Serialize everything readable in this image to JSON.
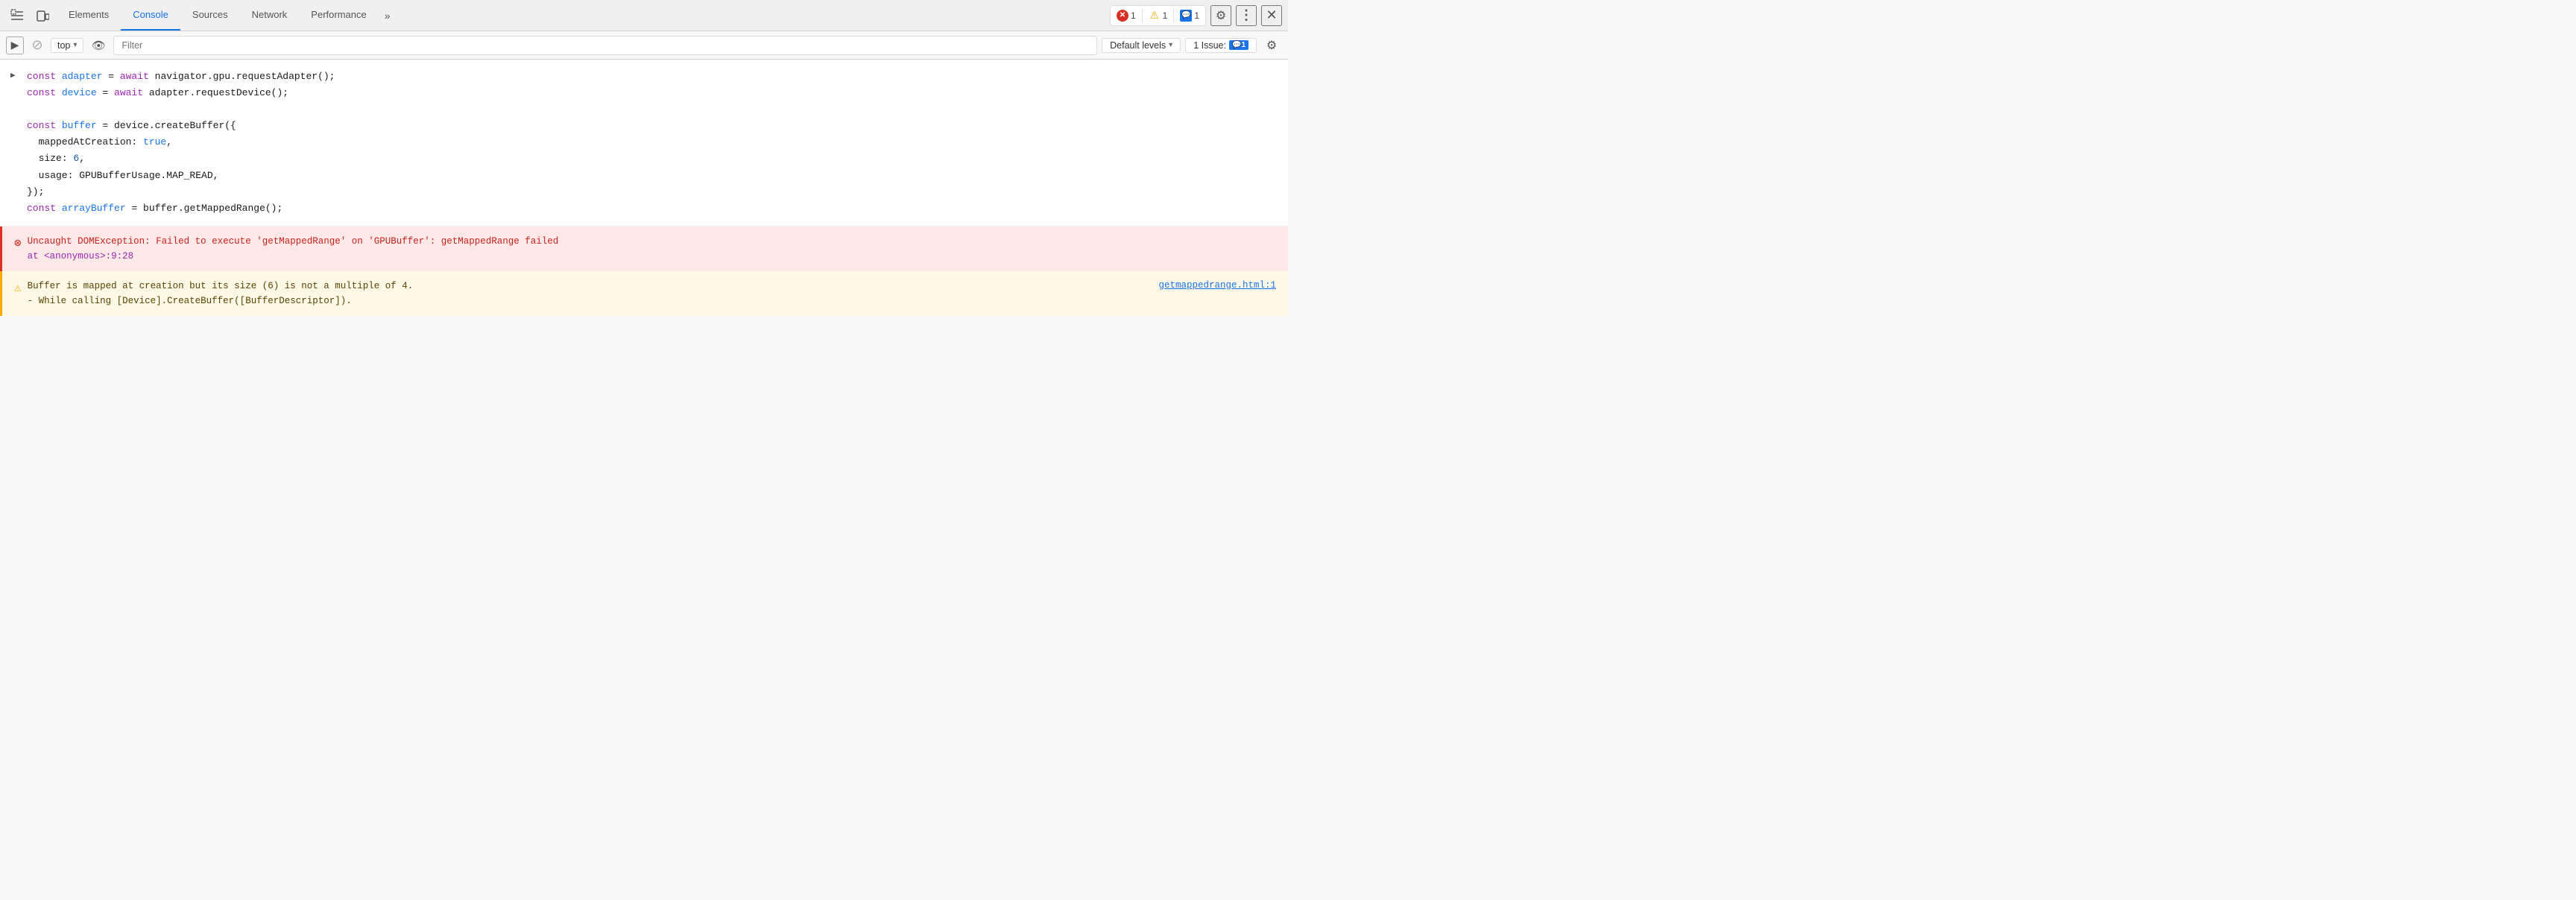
{
  "toolbar": {
    "inspect_icon": "⊹",
    "device_icon": "⬜",
    "tabs": [
      {
        "label": "Elements",
        "active": false
      },
      {
        "label": "Console",
        "active": true
      },
      {
        "label": "Sources",
        "active": false
      },
      {
        "label": "Network",
        "active": false
      },
      {
        "label": "Performance",
        "active": false
      }
    ],
    "more_label": "»",
    "error_count": "1",
    "warning_count": "1",
    "issue_count": "1",
    "gear_icon": "⚙",
    "dots_icon": "⋮",
    "close_icon": "✕"
  },
  "secondbar": {
    "sidebar_icon": "▶",
    "clear_icon": "⊘",
    "context_label": "top",
    "eye_icon": "👁",
    "filter_placeholder": "Filter",
    "level_label": "Default levels",
    "issues_label": "1 Issue:",
    "issues_count": "1",
    "gear_icon": "⚙"
  },
  "console": {
    "code_lines": [
      {
        "type": "code",
        "has_arrow": true,
        "parts": [
          {
            "text": "const ",
            "class": "c-purple"
          },
          {
            "text": "adapter",
            "class": "c-blue"
          },
          {
            "text": " = ",
            "class": "c-black"
          },
          {
            "text": "await ",
            "class": "c-purple"
          },
          {
            "text": "navigator.gpu.requestAdapter();",
            "class": "c-black"
          }
        ]
      },
      {
        "type": "code",
        "has_arrow": false,
        "parts": [
          {
            "text": "const ",
            "class": "c-purple"
          },
          {
            "text": "device",
            "class": "c-blue"
          },
          {
            "text": " = ",
            "class": "c-black"
          },
          {
            "text": "await ",
            "class": "c-purple"
          },
          {
            "text": "adapter.requestDevice();",
            "class": "c-black"
          }
        ]
      },
      {
        "type": "blank"
      },
      {
        "type": "code",
        "has_arrow": false,
        "parts": [
          {
            "text": "const ",
            "class": "c-purple"
          },
          {
            "text": "buffer",
            "class": "c-blue"
          },
          {
            "text": " = device.createBuffer({",
            "class": "c-black"
          }
        ]
      },
      {
        "type": "code",
        "has_arrow": false,
        "indent": true,
        "parts": [
          {
            "text": "  mappedAtCreation: ",
            "class": "c-black"
          },
          {
            "text": "true",
            "class": "c-blue"
          },
          {
            "text": ",",
            "class": "c-black"
          }
        ]
      },
      {
        "type": "code",
        "has_arrow": false,
        "indent": true,
        "parts": [
          {
            "text": "  size: ",
            "class": "c-black"
          },
          {
            "text": "6",
            "class": "c-number"
          },
          {
            "text": ",",
            "class": "c-black"
          }
        ]
      },
      {
        "type": "code",
        "has_arrow": false,
        "indent": true,
        "parts": [
          {
            "text": "  usage: GPUBufferUsage.MAP_READ,",
            "class": "c-black"
          }
        ]
      },
      {
        "type": "code",
        "has_arrow": false,
        "parts": [
          {
            "text": "});",
            "class": "c-black"
          }
        ]
      },
      {
        "type": "code",
        "has_arrow": false,
        "parts": [
          {
            "text": "const ",
            "class": "c-purple"
          },
          {
            "text": "arrayBuffer",
            "class": "c-blue"
          },
          {
            "text": " = buffer.getMappedRange();",
            "class": "c-black"
          }
        ]
      }
    ],
    "error": {
      "message": "Uncaught DOMException: Failed to execute 'getMappedRange' on 'GPUBuffer': getMappedRange failed",
      "location": "    at <anonymous>:9:28"
    },
    "warning": {
      "message": "Buffer is mapped at creation but its size (6) is not a multiple of 4.",
      "sub_message": "  - While calling [Device].CreateBuffer([BufferDescriptor]).",
      "link_text": "getmappedrange.html:1"
    }
  }
}
